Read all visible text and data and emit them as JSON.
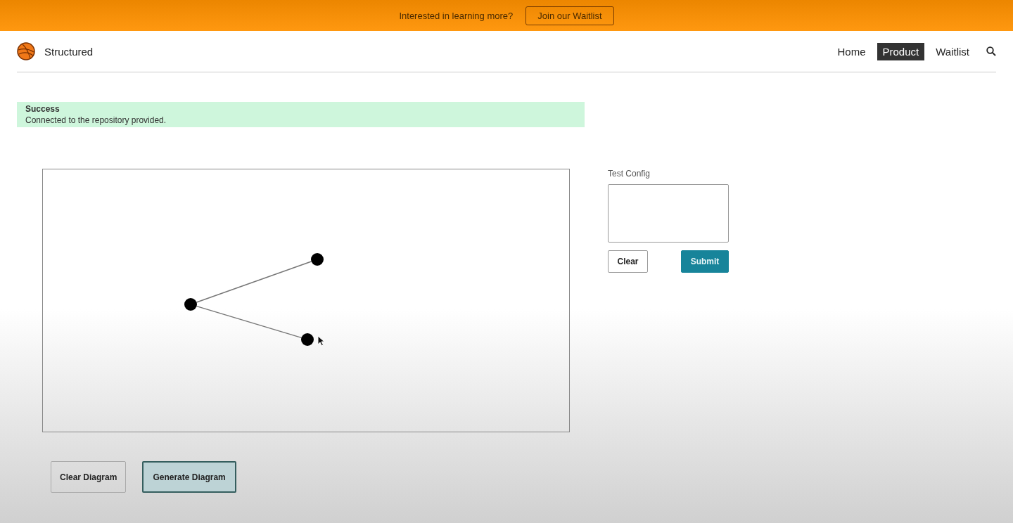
{
  "banner": {
    "text": "Interested in learning more?",
    "button": "Join our Waitlist"
  },
  "header": {
    "brand": "Structured",
    "nav": [
      {
        "label": "Home",
        "selected": false
      },
      {
        "label": "Product",
        "selected": true
      },
      {
        "label": "Waitlist",
        "selected": false
      }
    ]
  },
  "alert": {
    "title": "Success",
    "message": "Connected to the repository provided."
  },
  "config": {
    "label": "Test Config",
    "buttons": [
      {
        "label": "Clear",
        "kind": "secondary"
      },
      {
        "label": "Submit",
        "kind": "primary"
      }
    ]
  },
  "diagram_buttons": [
    {
      "label": "Clear Diagram",
      "kind": "secondary"
    },
    {
      "label": "Generate Diagram",
      "kind": "primary"
    }
  ]
}
